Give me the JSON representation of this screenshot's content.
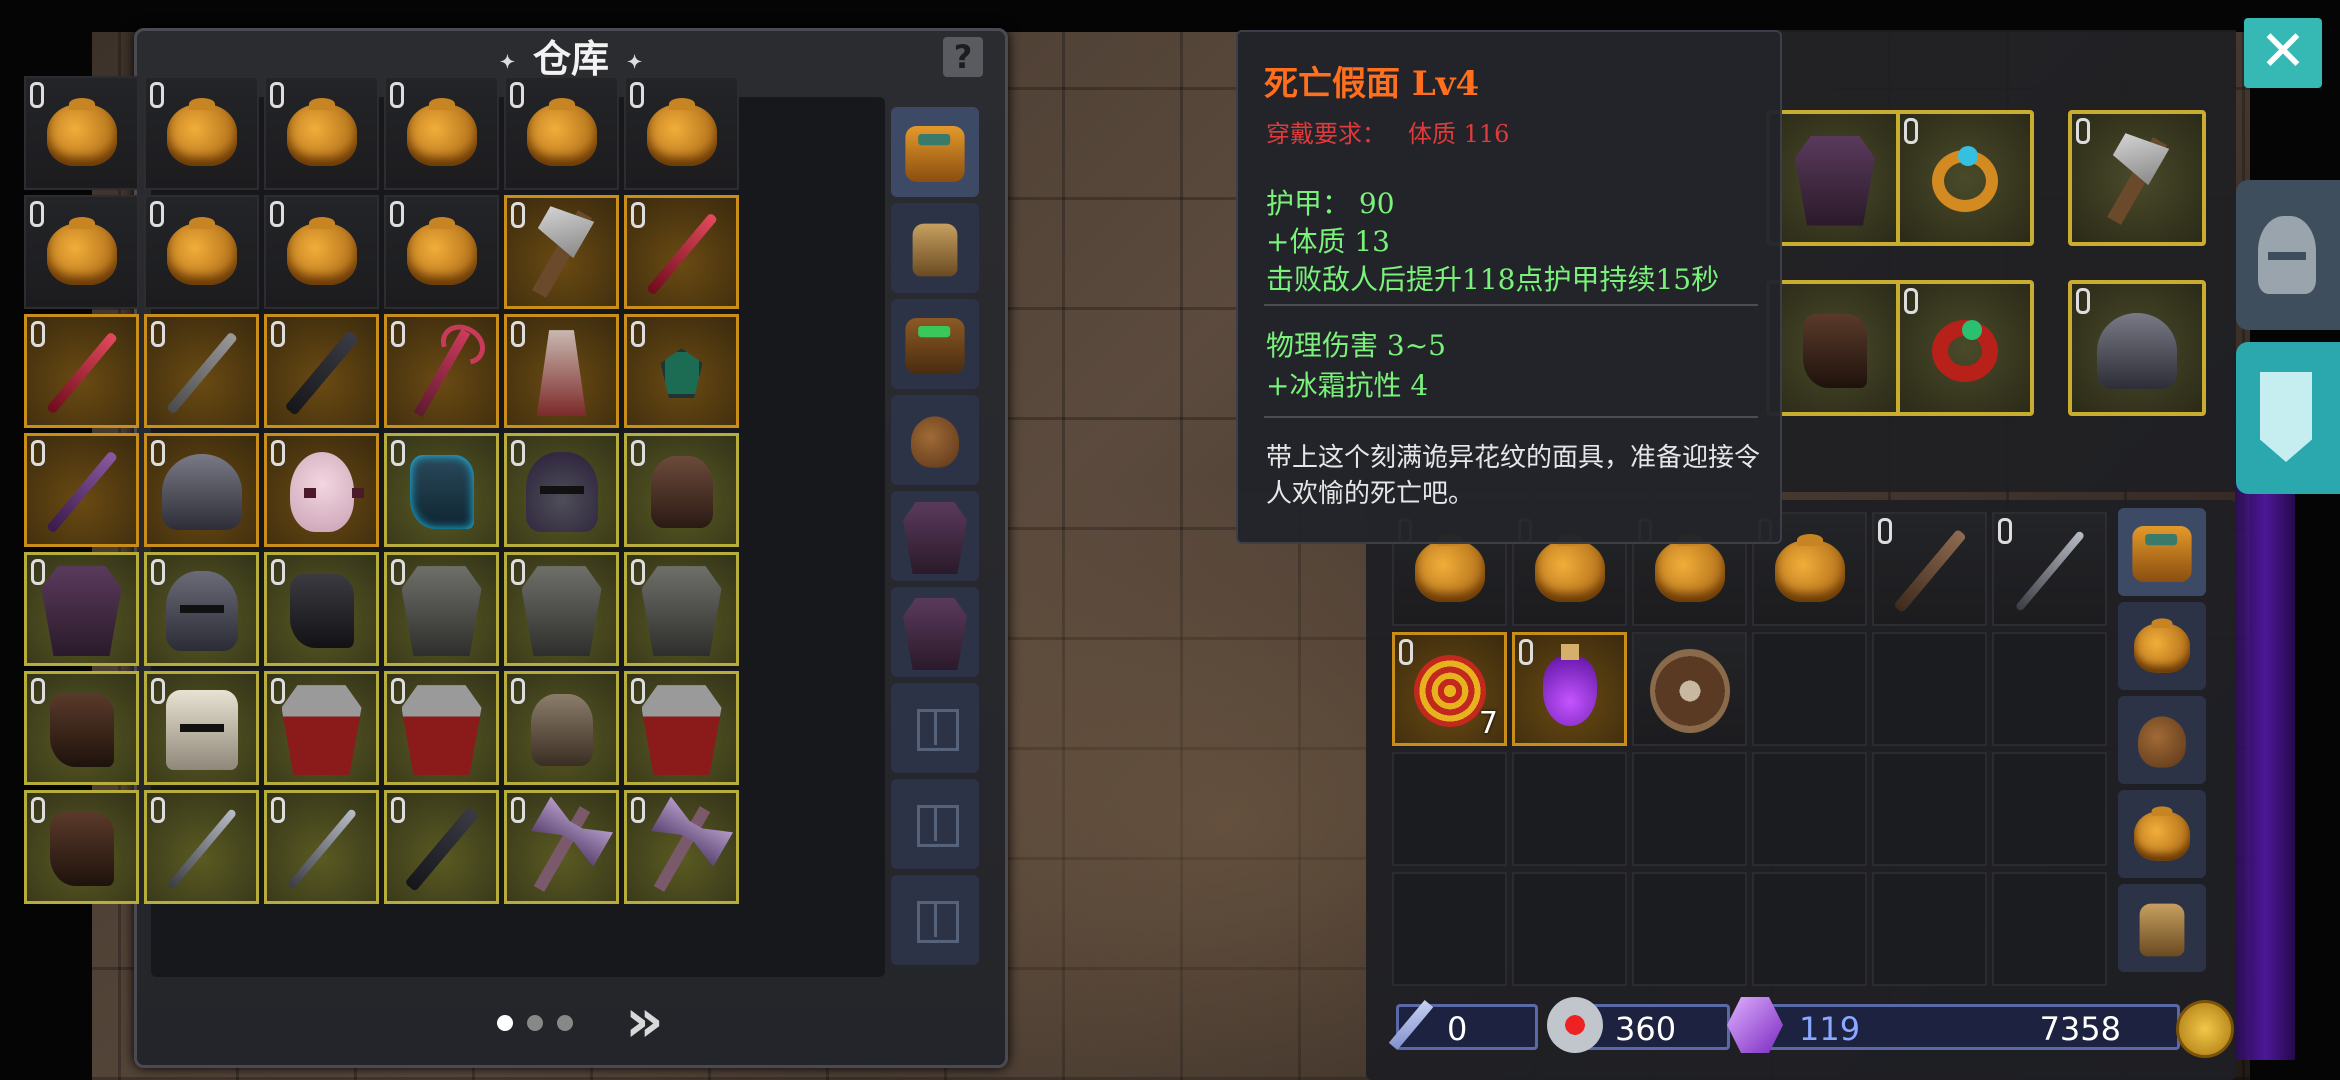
{
  "warehouse": {
    "title": "仓库",
    "help_label": "?",
    "pager": {
      "pages": 3,
      "current": 1,
      "next_label": "»"
    },
    "tabs": [
      "backpack-orange",
      "satchel",
      "backpack-green",
      "sack",
      "chest-armor",
      "chest-armor",
      "locked",
      "locked",
      "locked"
    ],
    "slots": [
      {
        "icon": "bag",
        "quality": "dark",
        "locked": true
      },
      {
        "icon": "bag",
        "quality": "dark",
        "locked": true
      },
      {
        "icon": "bag",
        "quality": "dark",
        "locked": true
      },
      {
        "icon": "bag",
        "quality": "dark",
        "locked": true
      },
      {
        "icon": "bag",
        "quality": "dark",
        "locked": true
      },
      {
        "icon": "bag",
        "quality": "dark",
        "locked": true
      },
      {
        "icon": "bag",
        "quality": "dark",
        "locked": true
      },
      {
        "icon": "bag",
        "quality": "dark",
        "locked": true
      },
      {
        "icon": "bag",
        "quality": "dark",
        "locked": true
      },
      {
        "icon": "bag",
        "quality": "dark",
        "locked": true
      },
      {
        "icon": "axe",
        "quality": "orange",
        "locked": true
      },
      {
        "icon": "sword",
        "quality": "orange",
        "locked": true
      },
      {
        "icon": "sword",
        "quality": "orange",
        "locked": true
      },
      {
        "icon": "sword-grey",
        "quality": "orange",
        "locked": true
      },
      {
        "icon": "sword-dark",
        "quality": "orange",
        "locked": true
      },
      {
        "icon": "staff",
        "quality": "orange",
        "locked": true
      },
      {
        "icon": "robe",
        "quality": "orange",
        "locked": true
      },
      {
        "icon": "amulet",
        "quality": "orange",
        "locked": true
      },
      {
        "icon": "sword-purple",
        "quality": "orange",
        "locked": true
      },
      {
        "icon": "pauldron",
        "quality": "orange",
        "locked": true
      },
      {
        "icon": "mask",
        "quality": "orange",
        "locked": true
      },
      {
        "icon": "boot",
        "quality": "yellow",
        "locked": true
      },
      {
        "icon": "helm-hood",
        "quality": "yellow",
        "locked": true
      },
      {
        "icon": "glove",
        "quality": "yellow",
        "locked": true
      },
      {
        "icon": "armor-purple",
        "quality": "yellow",
        "locked": true
      },
      {
        "icon": "helm",
        "quality": "yellow",
        "locked": true
      },
      {
        "icon": "boot-dark",
        "quality": "yellow",
        "locked": true
      },
      {
        "icon": "armor",
        "quality": "yellow",
        "locked": true
      },
      {
        "icon": "armor",
        "quality": "yellow",
        "locked": true
      },
      {
        "icon": "armor",
        "quality": "yellow",
        "locked": true
      },
      {
        "icon": "boot-brown",
        "quality": "yellow",
        "locked": true
      },
      {
        "icon": "helm-cream",
        "quality": "yellow",
        "locked": true
      },
      {
        "icon": "armor-red",
        "quality": "yellow",
        "locked": true
      },
      {
        "icon": "armor-red",
        "quality": "yellow",
        "locked": true
      },
      {
        "icon": "glove-light",
        "quality": "yellow",
        "locked": true
      },
      {
        "icon": "armor-red",
        "quality": "yellow",
        "locked": true
      },
      {
        "icon": "boot-brown",
        "quality": "yellow",
        "locked": true
      },
      {
        "icon": "sword-steel",
        "quality": "yellow",
        "locked": true
      },
      {
        "icon": "sword-steel",
        "quality": "yellow",
        "locked": true
      },
      {
        "icon": "sword-dark",
        "quality": "yellow",
        "locked": true
      },
      {
        "icon": "dblaxe",
        "quality": "yellow",
        "locked": true
      },
      {
        "icon": "dblaxe",
        "quality": "yellow",
        "locked": true
      }
    ]
  },
  "tooltip": {
    "title": "死亡假面  Lv4",
    "req_label": "穿戴要求：",
    "req_value": "体质  116",
    "stats_a": [
      "护甲：  90",
      "+体质  13",
      "击败敌人后提升118点护甲持续15秒"
    ],
    "stats_b": [
      "物理伤害  3~5",
      "+冰霜抗性  4"
    ],
    "description": "带上这个刻满诡异花纹的面具，准备迎接令人欢愉的死亡吧。",
    "colors": {
      "title": "#ff6f1e",
      "requirement": "#e03a3a",
      "stat": "#7af27a"
    }
  },
  "equipment": [
    {
      "slot": "chest",
      "icon": "armor-purple"
    },
    {
      "slot": "ring-1",
      "icon": "ring"
    },
    {
      "slot": "weapon",
      "icon": "axe"
    },
    {
      "slot": "boots",
      "icon": "boot-brown"
    },
    {
      "slot": "ring-2",
      "icon": "ring-red"
    },
    {
      "slot": "shoulder",
      "icon": "pauldron"
    }
  ],
  "inventory": {
    "tabs": [
      "backpack-orange",
      "bag",
      "sack",
      "bag",
      "satchel"
    ],
    "slots": [
      {
        "icon": "bag",
        "quality": "dark",
        "locked": true
      },
      {
        "icon": "bag",
        "quality": "dark",
        "locked": true
      },
      {
        "icon": "bag",
        "quality": "dark",
        "locked": true
      },
      {
        "icon": "bag",
        "quality": "dark",
        "locked": true
      },
      {
        "icon": "sword-brown",
        "quality": "dark",
        "locked": true
      },
      {
        "icon": "sword-steel",
        "quality": "dark",
        "locked": true
      },
      {
        "icon": "spiral",
        "quality": "orange",
        "locked": true,
        "count": "7"
      },
      {
        "icon": "potion",
        "quality": "orange",
        "locked": true
      },
      {
        "icon": "shield",
        "quality": "dark",
        "locked": false
      },
      {
        "icon": "",
        "quality": "empty"
      },
      {
        "icon": "",
        "quality": "empty"
      },
      {
        "icon": "",
        "quality": "empty"
      },
      {
        "icon": "",
        "quality": "empty"
      },
      {
        "icon": "",
        "quality": "empty"
      },
      {
        "icon": "",
        "quality": "empty"
      },
      {
        "icon": "",
        "quality": "empty"
      },
      {
        "icon": "",
        "quality": "empty"
      },
      {
        "icon": "",
        "quality": "empty"
      },
      {
        "icon": "",
        "quality": "empty"
      },
      {
        "icon": "",
        "quality": "empty"
      },
      {
        "icon": "",
        "quality": "empty"
      },
      {
        "icon": "",
        "quality": "empty"
      },
      {
        "icon": "",
        "quality": "empty"
      },
      {
        "icon": "",
        "quality": "empty"
      }
    ]
  },
  "currency": {
    "wand": "0",
    "heart": "360",
    "gem": "119",
    "gold": "7358"
  },
  "buttons": {
    "close_label": "✕"
  }
}
